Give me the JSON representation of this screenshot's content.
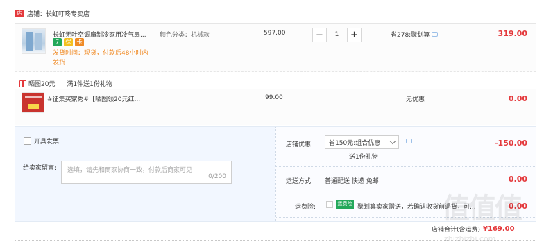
{
  "shop": {
    "label": "店铺：长虹叮咚专卖店",
    "icon": "shop-icon"
  },
  "item1": {
    "title": "长虹无叶空调扇制冷家用冷气扇...",
    "spec": "颜色分类：机械款",
    "shipping": "发货时间：现货，付款后48小时内发货",
    "price": "597.00",
    "quantity": "1",
    "minus": "−",
    "plus": "+",
    "promo": "省278:聚划算",
    "total": "319.00",
    "badges": [
      "7",
      "保",
      "卡"
    ]
  },
  "gift": {
    "label": "晒图20元",
    "tag": "满1件送1份礼物"
  },
  "item2": {
    "title": "#征集买家秀#【晒图领20元红...",
    "price": "99.00",
    "promo": "无优惠",
    "total": "0.00"
  },
  "checkbox_label": "开具发票",
  "message": {
    "label": "给卖家留言:",
    "placeholder": "选填，请先和商家协商一致，付款后商家可见",
    "counter": "0/200"
  },
  "discount": {
    "label": "店铺优惠:",
    "selected": "省150元:组合优惠",
    "gift": "送1份礼物",
    "value": "-150.00"
  },
  "shipping_method": {
    "label": "运送方式:",
    "value": "普通配送 快递 免邮",
    "amount": "0.00"
  },
  "insurance": {
    "label": "运费险:",
    "tag": "运费险",
    "text": "聚划算卖家赠送，若确认收货前退货，可...",
    "amount": "0.00"
  },
  "summary": {
    "label": "店铺合计(含运费)",
    "value": "¥169.00"
  },
  "watermark": {
    "big": "值值值",
    "small": "zhizhizhi.com"
  },
  "colors": {
    "accent": "#e4393c",
    "orange": "#f08a24",
    "green": "#23a85a"
  }
}
